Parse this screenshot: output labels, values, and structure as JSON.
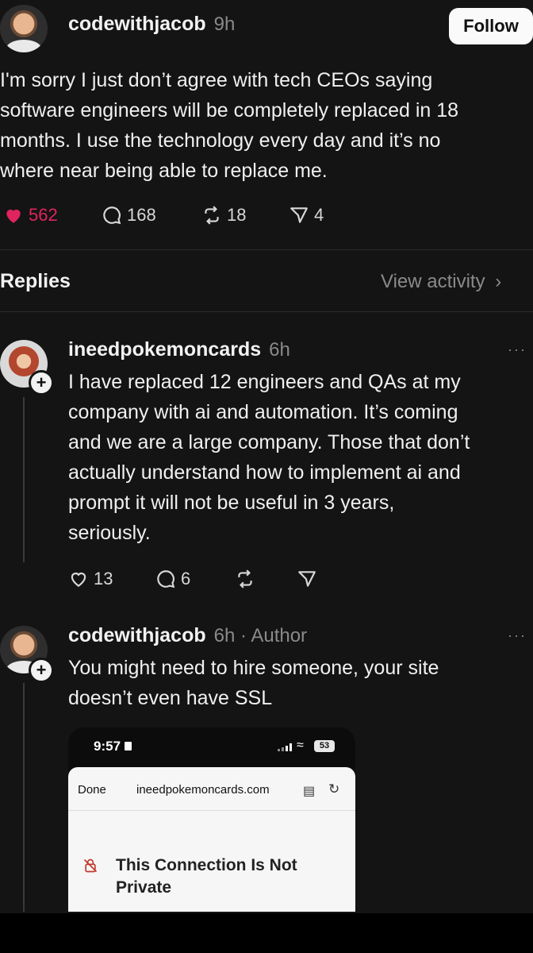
{
  "post": {
    "username": "codewithjacob",
    "time": "9h",
    "follow_label": "Follow",
    "lines": [
      "I'm sorry I just don’t agree with tech CEOs saying",
      "software engineers will be completely replaced in 18",
      "months. I use the technology every day and it’s no",
      "where near being able to replace me."
    ],
    "likes": "562",
    "comments": "168",
    "reposts": "18",
    "shares": "4",
    "like_color": "#e0245e"
  },
  "replies_header": {
    "title": "Replies",
    "view_activity": "View activity",
    "chevron": "›"
  },
  "reply1": {
    "username": "ineedpokemoncards",
    "time": "6h",
    "more": "···",
    "lines": [
      "I have replaced 12 engineers and QAs at my",
      "company with ai and automation. It’s coming",
      "and we are a large company. Those that don’t",
      "actually understand how to implement ai and",
      "prompt it will not be useful in 3 years,",
      "seriously."
    ],
    "likes": "13",
    "comments": "6"
  },
  "reply2": {
    "username": "codewithjacob",
    "time": "6h · Author",
    "more": "···",
    "lines": [
      "You might need to hire someone, your site",
      "doesn’t even have SSL"
    ]
  },
  "screenshot": {
    "clock": "9:57",
    "battery": "53",
    "done": "Done",
    "url": "ineedpokemoncards.com",
    "warning_line1": "This Connection Is Not",
    "warning_line2": "Private"
  },
  "plus": "+"
}
